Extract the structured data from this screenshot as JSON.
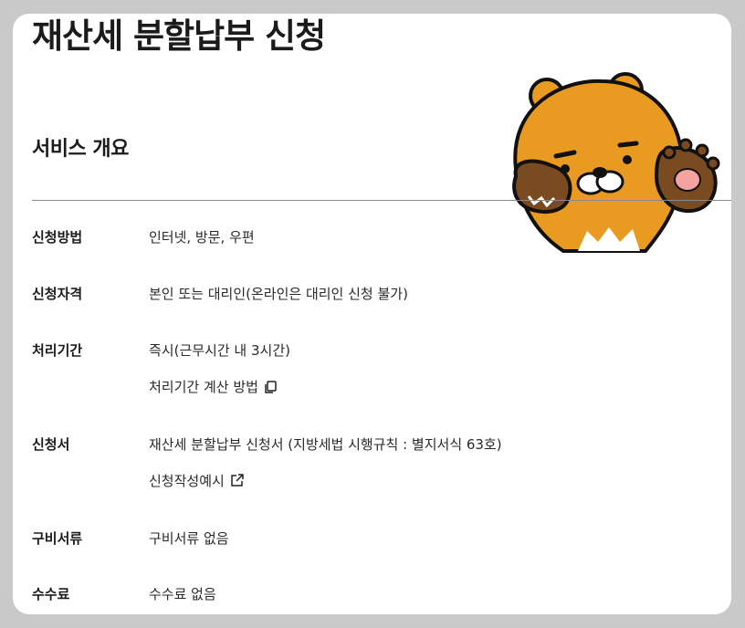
{
  "page": {
    "title": "재산세 분할납부 신청",
    "section_title": "서비스 개요"
  },
  "rows": [
    {
      "label": "신청방법",
      "value": "인터넷, 방문, 우편"
    },
    {
      "label": "신청자격",
      "value": "본인 또는 대리인(온라인은 대리인 신청 불가)"
    },
    {
      "label": "처리기간",
      "value": "즉시(근무시간 내 3시간)",
      "link": "처리기간 계산 방법",
      "link_icon": "copy-icon"
    },
    {
      "label": "신청서",
      "value": "재산세 분할납부 신청서 (지방세법 시행규칙 : 별지서식 63호)",
      "link": "신청작성예시",
      "link_icon": "external-link-icon"
    },
    {
      "label": "구비서류",
      "value": "구비서류 없음"
    },
    {
      "label": "수수료",
      "value": "수수료 없음"
    }
  ],
  "colors": {
    "background": "#c9c9c9",
    "card": "#ffffff",
    "text": "#1b1b1b",
    "mascot_body": "#E99A21"
  },
  "mascot": {
    "name": "ryan-mascot"
  }
}
